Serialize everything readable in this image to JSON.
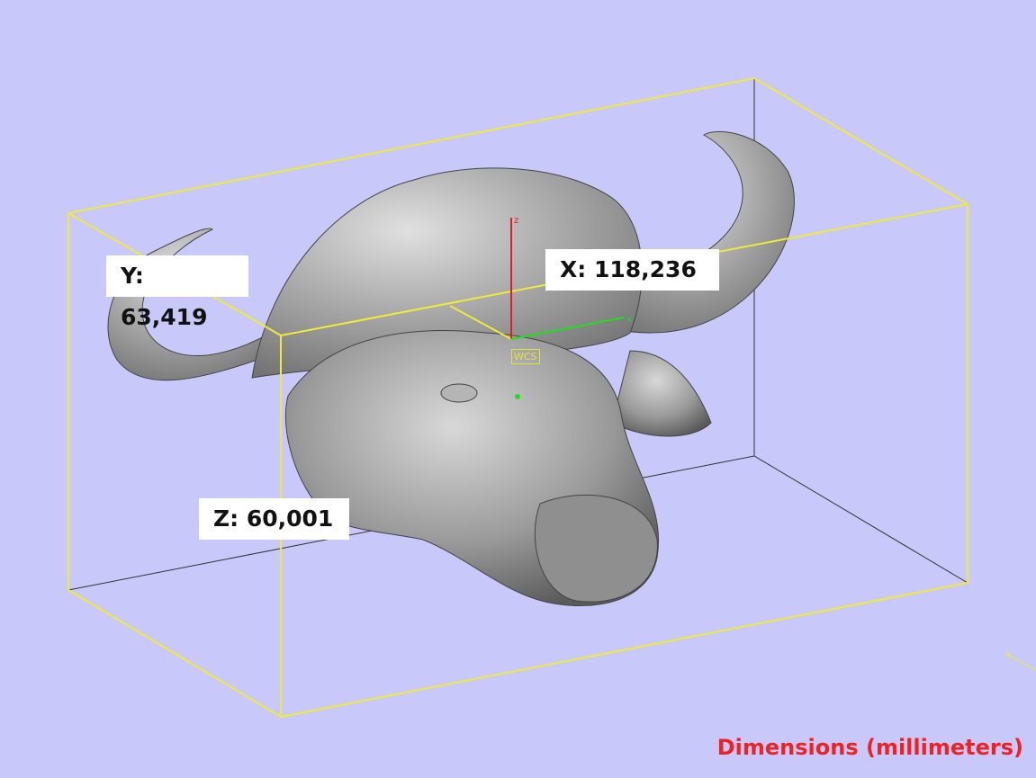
{
  "viewport": {
    "background": "#c8c8fa",
    "bbox_color": "#f0ea3a",
    "model": "buffalo-head-mesh"
  },
  "dimensions": {
    "x_label": "X: 118,236",
    "y_label": "Y: 63,419",
    "z_label": "Z: 60,001",
    "units_label": "Dimensions (millimeters)"
  },
  "wcs": {
    "label": "WCS",
    "axis_x": "x",
    "axis_z": "z",
    "corner_axis_y": "Y"
  }
}
